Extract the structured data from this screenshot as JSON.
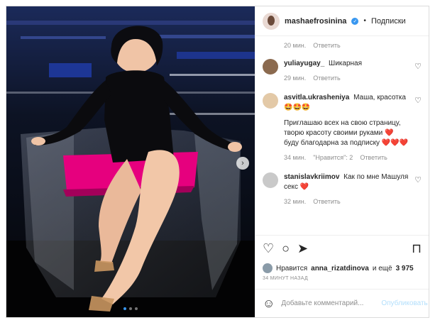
{
  "header": {
    "username": "mashaefrosinina",
    "separator": "•",
    "follow_label": "Подписки"
  },
  "top_meta": {
    "time": "20 мин.",
    "reply": "Ответить"
  },
  "comments": [
    {
      "user": "yuliayugay_",
      "text": "Шикарная",
      "time": "29 мин.",
      "reply": "Ответить",
      "avatar_color": "#8b6a4f"
    },
    {
      "user": "asvitla.ukrasheniya",
      "text": "Маша, красотка",
      "emojis": "🤩🤩🤩",
      "text2": "Приглашаю всех на свою страницу, творю красоту своими руками",
      "hearts1": "❤️",
      "text3": "буду благодарна за подписку",
      "hearts2": "❤️❤️❤️",
      "time": "34 мин.",
      "likes": "\"Нравится\": 2",
      "reply": "Ответить",
      "avatar_color": "#e3c9a7"
    },
    {
      "user": "stanislavkriimov",
      "text": "Как по мне Машуля секс",
      "hearts": "❤️",
      "time": "32 мин.",
      "reply": "Ответить",
      "avatar_color": "#c9c9c9"
    }
  ],
  "likes_line": {
    "prefix": "Нравится",
    "user": "anna_rizatdinova",
    "suffix": "и ещё",
    "count": "3 975"
  },
  "timestamp": "34 МИНУТ НАЗАД",
  "add_comment": {
    "placeholder": "Добавьте комментарий...",
    "post_label": "Опубликовать"
  },
  "carousel": {
    "slides": 3,
    "active": 1
  },
  "colors": {
    "accent": "#3897f0",
    "heart": "#ed4956",
    "seat": "#e6007e"
  }
}
